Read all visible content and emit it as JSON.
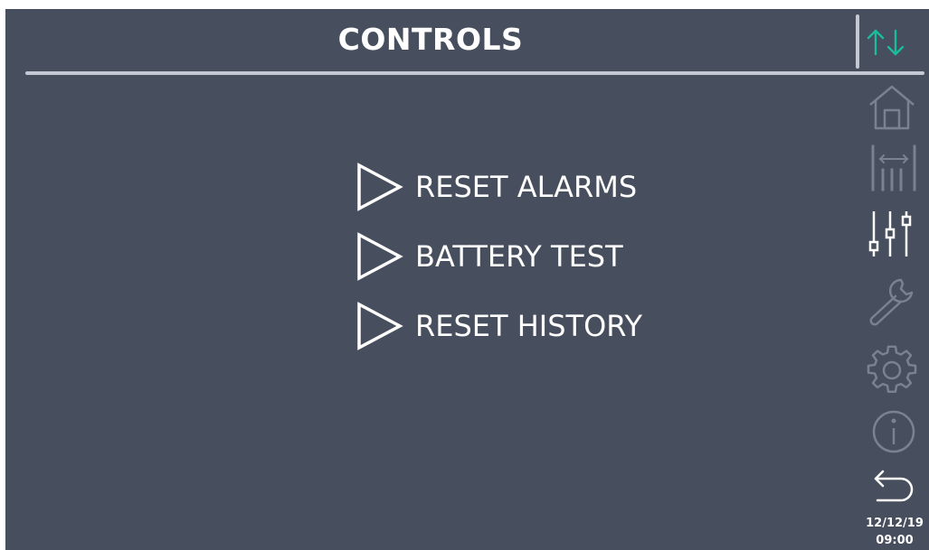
{
  "header": {
    "title": "CONTROLS"
  },
  "menu": {
    "items": [
      {
        "label": "RESET ALARMS",
        "icon": "play-triangle-icon"
      },
      {
        "label": "BATTERY TEST",
        "icon": "play-triangle-icon"
      },
      {
        "label": "RESET HISTORY",
        "icon": "play-triangle-icon"
      }
    ]
  },
  "sidebar": {
    "items": [
      {
        "name": "home",
        "icon": "home-icon",
        "active": false
      },
      {
        "name": "measurements",
        "icon": "measurements-icon",
        "active": false
      },
      {
        "name": "controls",
        "icon": "sliders-icon",
        "active": true
      },
      {
        "name": "service",
        "icon": "wrench-icon",
        "active": false
      },
      {
        "name": "settings",
        "icon": "gear-icon",
        "active": false
      },
      {
        "name": "info",
        "icon": "info-icon",
        "active": false
      },
      {
        "name": "back",
        "icon": "back-arrow-icon",
        "active": false
      }
    ]
  },
  "status": {
    "date": "12/12/19",
    "time": "09:00",
    "comm_icon": "communication-arrows-icon"
  },
  "colors": {
    "background": "#474e5d",
    "text": "#ffffff",
    "accent": "#1abc9c",
    "inactive_icon": "#7a8190",
    "divider": "#c3c8d3"
  }
}
